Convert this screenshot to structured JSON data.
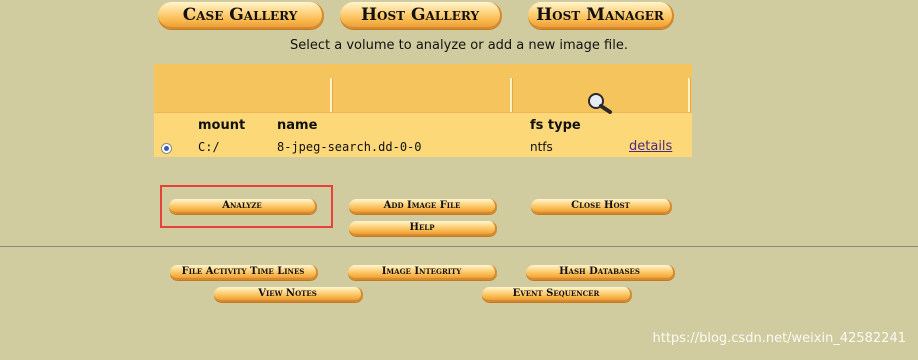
{
  "instruction": "Select a volume to analyze or add a new image file.",
  "tabs": [
    {
      "label": "Case Gallery"
    },
    {
      "label": "Host Gallery"
    },
    {
      "label": "Host Manager"
    }
  ],
  "volume_table": {
    "columns": [
      "mount",
      "name",
      "fs type"
    ],
    "rows": [
      {
        "mount": "C:/",
        "name": "8-jpeg-search.dd-0-0",
        "fs_type": "ntfs",
        "link": "details",
        "selected": true
      }
    ]
  },
  "actions": {
    "analyze": "Analyze",
    "add_image_file": "Add Image File",
    "close_host": "Close Host",
    "help": "Help"
  },
  "tools": {
    "file_activity": "File Activity Time Lines",
    "image_integrity": "Image Integrity",
    "hash_databases": "Hash Databases",
    "view_notes": "View Notes",
    "event_sequencer": "Event Sequencer"
  },
  "watermark": "https://blog.csdn.net/weixin_42582241",
  "colors": {
    "background": "#d0cc9f",
    "panel": "#fdd878",
    "button": "#f8b84c",
    "highlight": "#e8403a",
    "link": "#4b2a80"
  },
  "icons": [
    "magnifier-icon",
    "radio-selected-icon"
  ]
}
